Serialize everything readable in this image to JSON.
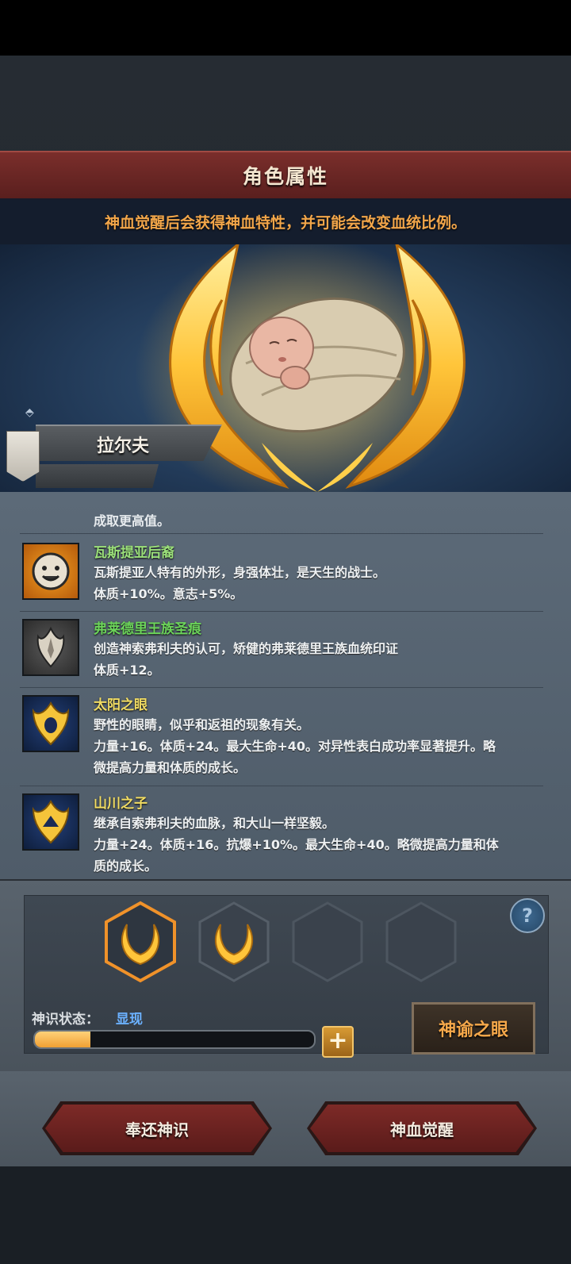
{
  "header": {
    "title": "角色属性",
    "subtitle": "神血觉醒后会获得神血特性，并可能会改变血统比例。"
  },
  "character": {
    "name": "拉尔夫"
  },
  "traits": {
    "partial_top": "成取更高值。",
    "items": [
      {
        "name": "瓦斯提亚后裔",
        "name_color": "#9be07a",
        "icon": "smiling-face-icon",
        "desc1": "瓦斯提亚人特有的外形，身强体壮，是天生的战士。",
        "desc2": "体质+10%。意志+5%。"
      },
      {
        "name": "弗莱德里王族圣痕",
        "name_color": "#6cd45a",
        "icon": "royal-crest-icon",
        "desc1": "创造神索弗利夫的认可，矫健的弗莱德里王族血统印证",
        "desc2": "体质+12。"
      },
      {
        "name": "太阳之眼",
        "name_color": "#f1dc63",
        "icon": "sun-eye-icon",
        "desc1": "野性的眼睛，似乎和返祖的现象有关。",
        "desc2": "力量+16。体质+24。最大生命+40。对异性表白成功率显著提升。略",
        "desc3": "微提高力量和体质的成长。"
      },
      {
        "name": "山川之子",
        "name_color": "#f1dc63",
        "icon": "mountain-crest-icon",
        "desc1": "继承自索弗利夫的血脉，和大山一样坚毅。",
        "desc2": "力量+24。体质+16。抗爆+10%。最大生命+40。略微提高力量和体",
        "desc3": "质的成长。"
      }
    ]
  },
  "awakening": {
    "help": "?",
    "status_label": "神识状态：",
    "status_value": "显现",
    "progress": 0.2,
    "plus": "+",
    "oracle_button": "神谕之眼"
  },
  "actions": {
    "return_button": "奉还神识",
    "awaken_button": "神血觉醒"
  },
  "colors": {
    "accent_orange": "#f6a84a",
    "title_red": "#7a2e2b",
    "status_blue": "#6bb1ff"
  }
}
